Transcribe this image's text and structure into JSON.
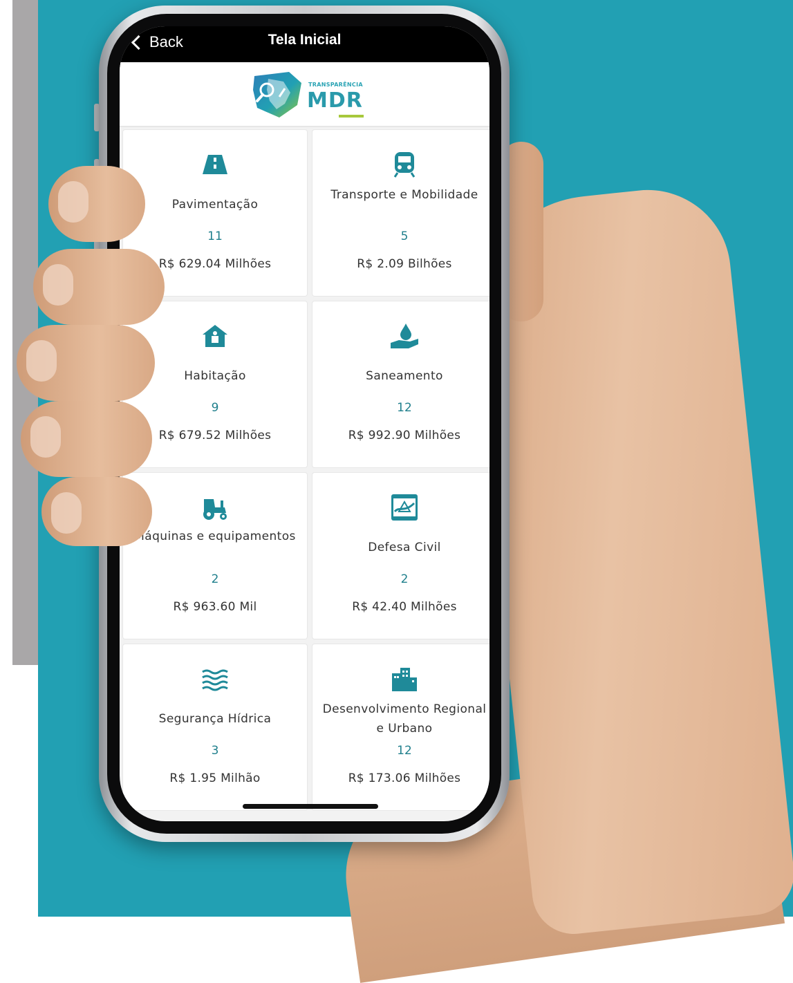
{
  "nav": {
    "back_label": "Back",
    "title": "Tela Inicial"
  },
  "logo": {
    "small_text": "TRANSPARÊNCIA",
    "big_text": "MDR"
  },
  "colors": {
    "accent": "#1f8a99",
    "background": "#22a0b3"
  },
  "cards": [
    {
      "icon": "road-icon",
      "title": "Pavimentação",
      "count": "11",
      "value": "R$ 629.04 Milhões"
    },
    {
      "icon": "train-icon",
      "title": "Transporte e Mobilidade",
      "count": "5",
      "value": "R$ 2.09 Bilhões"
    },
    {
      "icon": "house-icon",
      "title": "Habitação",
      "count": "9",
      "value": "R$ 679.52 Milhões"
    },
    {
      "icon": "water-drop-hand-icon",
      "title": "Saneamento",
      "count": "12",
      "value": "R$ 992.90 Milhões"
    },
    {
      "icon": "tractor-icon",
      "title": "Máquinas e equipamentos",
      "count": "2",
      "value": "R$ 963.60 Mil"
    },
    {
      "icon": "civil-defense-icon",
      "title": "Defesa Civil",
      "count": "2",
      "value": "R$ 42.40 Milhões"
    },
    {
      "icon": "water-waves-icon",
      "title": "Segurança Hídrica",
      "count": "3",
      "value": "R$ 1.95 Milhão"
    },
    {
      "icon": "city-buildings-icon",
      "title": "Desenvolvimento Regional e Urbano",
      "count": "12",
      "value": "R$ 173.06 Milhões"
    }
  ]
}
